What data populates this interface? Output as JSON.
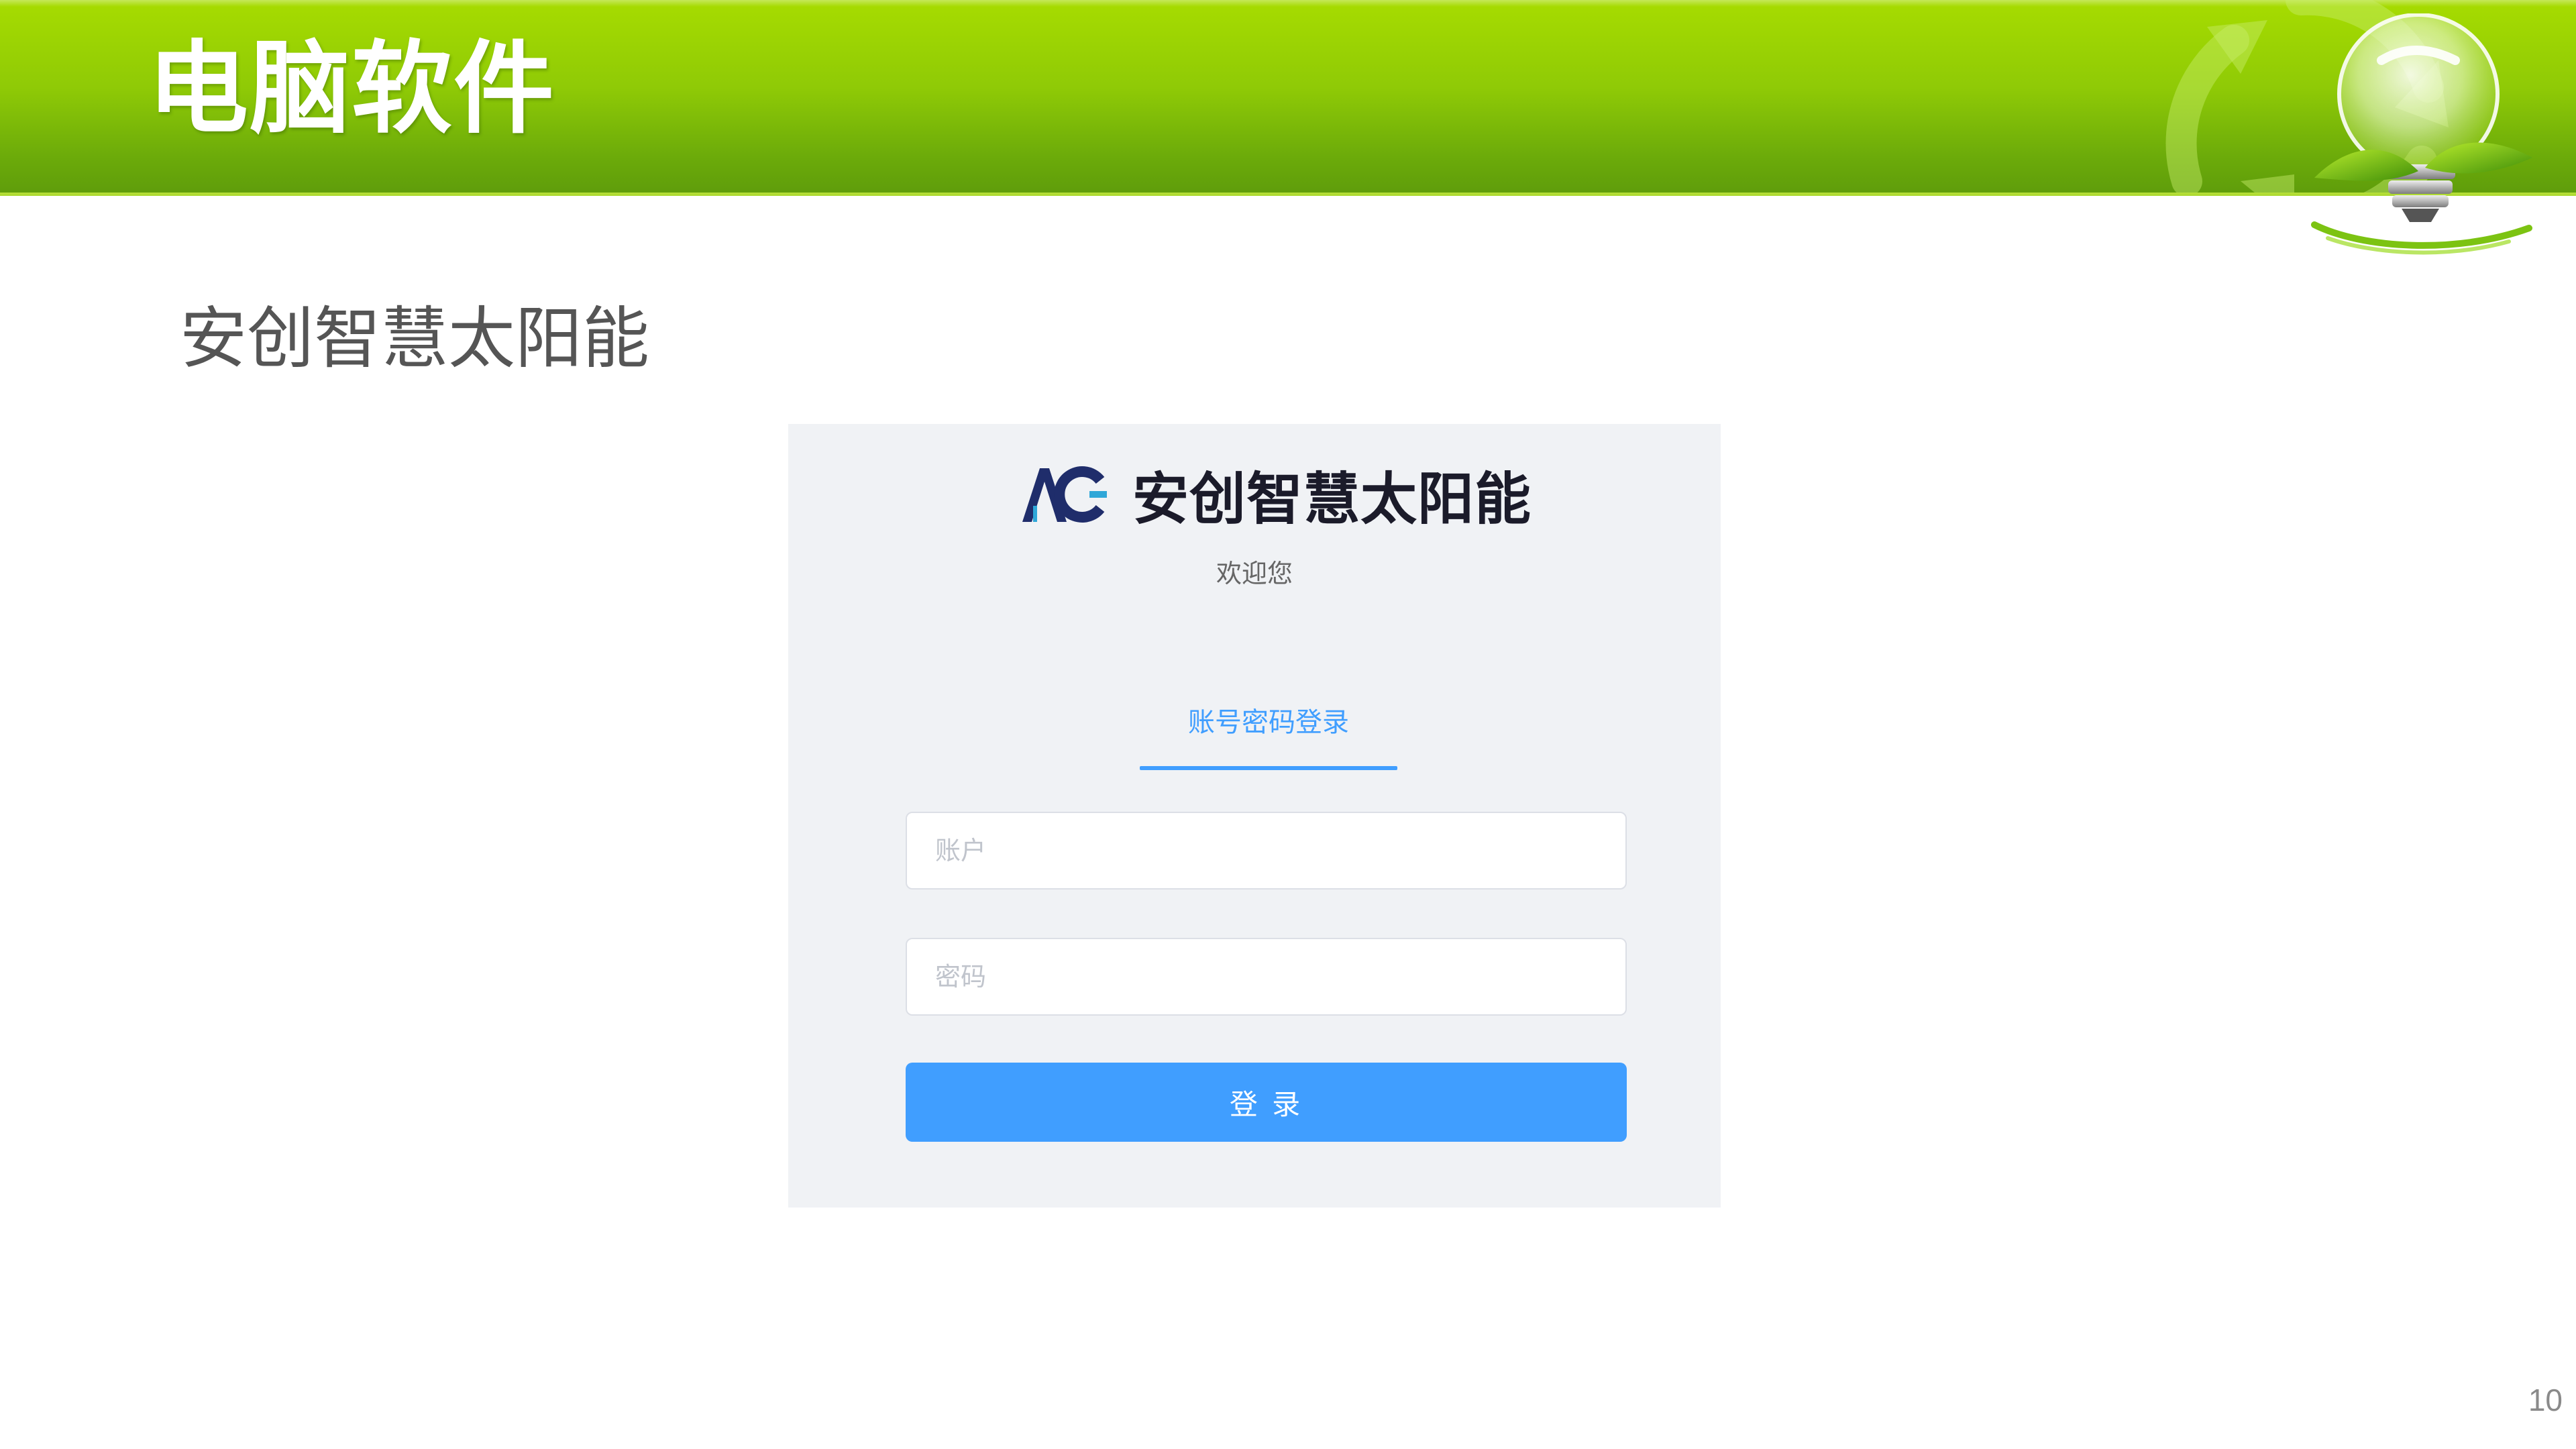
{
  "slide": {
    "title": "电脑软件",
    "subtitle": "安创智慧太阳能",
    "page_number": "10"
  },
  "login": {
    "logo_text": "AC",
    "brand_name": "安创智慧太阳能",
    "welcome": "欢迎您",
    "tab_label": "账号密码登录",
    "account_placeholder": "账户",
    "password_placeholder": "密码",
    "submit_label": "登 录"
  },
  "colors": {
    "header_green": "#8fca06",
    "primary_blue": "#409eff",
    "panel_bg": "#f0f2f5",
    "logo_navy": "#1f2d6b"
  },
  "icons": [
    "recycle-icon",
    "lightbulb-icon",
    "app-logo-icon"
  ]
}
